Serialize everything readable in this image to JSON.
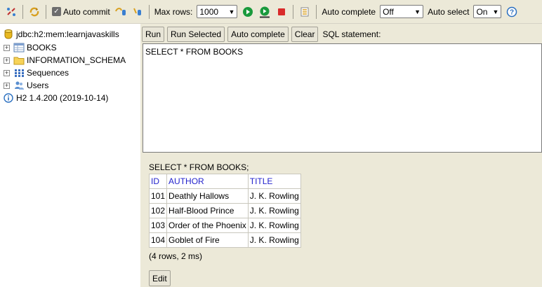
{
  "toolbar": {
    "auto_commit_label": "Auto commit",
    "max_rows_label": "Max rows:",
    "max_rows_value": "1000",
    "auto_complete_label": "Auto complete",
    "auto_complete_value": "Off",
    "auto_select_label": "Auto select",
    "auto_select_value": "On",
    "icons": [
      "disconnect-icon",
      "refresh-icon",
      "rollback-icon",
      "commit-icon",
      "run-icon",
      "run-selected-icon",
      "stop-icon",
      "history-icon",
      "help-icon"
    ]
  },
  "tree": {
    "connection": "jdbc:h2:mem:learnjavaskills",
    "items": [
      {
        "label": "BOOKS",
        "icon": "table-icon"
      },
      {
        "label": "INFORMATION_SCHEMA",
        "icon": "folder-icon"
      },
      {
        "label": "Sequences",
        "icon": "sequences-icon"
      },
      {
        "label": "Users",
        "icon": "users-icon"
      }
    ],
    "version": "H2 1.4.200 (2019-10-14)"
  },
  "buttons": {
    "run": "Run",
    "run_selected": "Run Selected",
    "auto_complete": "Auto complete",
    "clear": "Clear",
    "sql_caption": "SQL statement:"
  },
  "editor": {
    "text": "SELECT * FROM BOOKS"
  },
  "result": {
    "sql": "SELECT * FROM BOOKS;",
    "columns": [
      "ID",
      "AUTHOR",
      "TITLE"
    ],
    "rows": [
      [
        "101",
        "Deathly Hallows",
        "J. K. Rowling"
      ],
      [
        "102",
        "Half-Blood Prince",
        "J. K. Rowling"
      ],
      [
        "103",
        "Order of the Phoenix",
        "J. K. Rowling"
      ],
      [
        "104",
        "Goblet of Fire",
        "J. K. Rowling"
      ]
    ],
    "meta": "(4 rows, 2 ms)",
    "edit_label": "Edit"
  },
  "colors": {
    "panel": "#ece9d8",
    "header_link": "#2222cc",
    "run_green": "#1a9a3c",
    "stop_red": "#d92b2b"
  }
}
